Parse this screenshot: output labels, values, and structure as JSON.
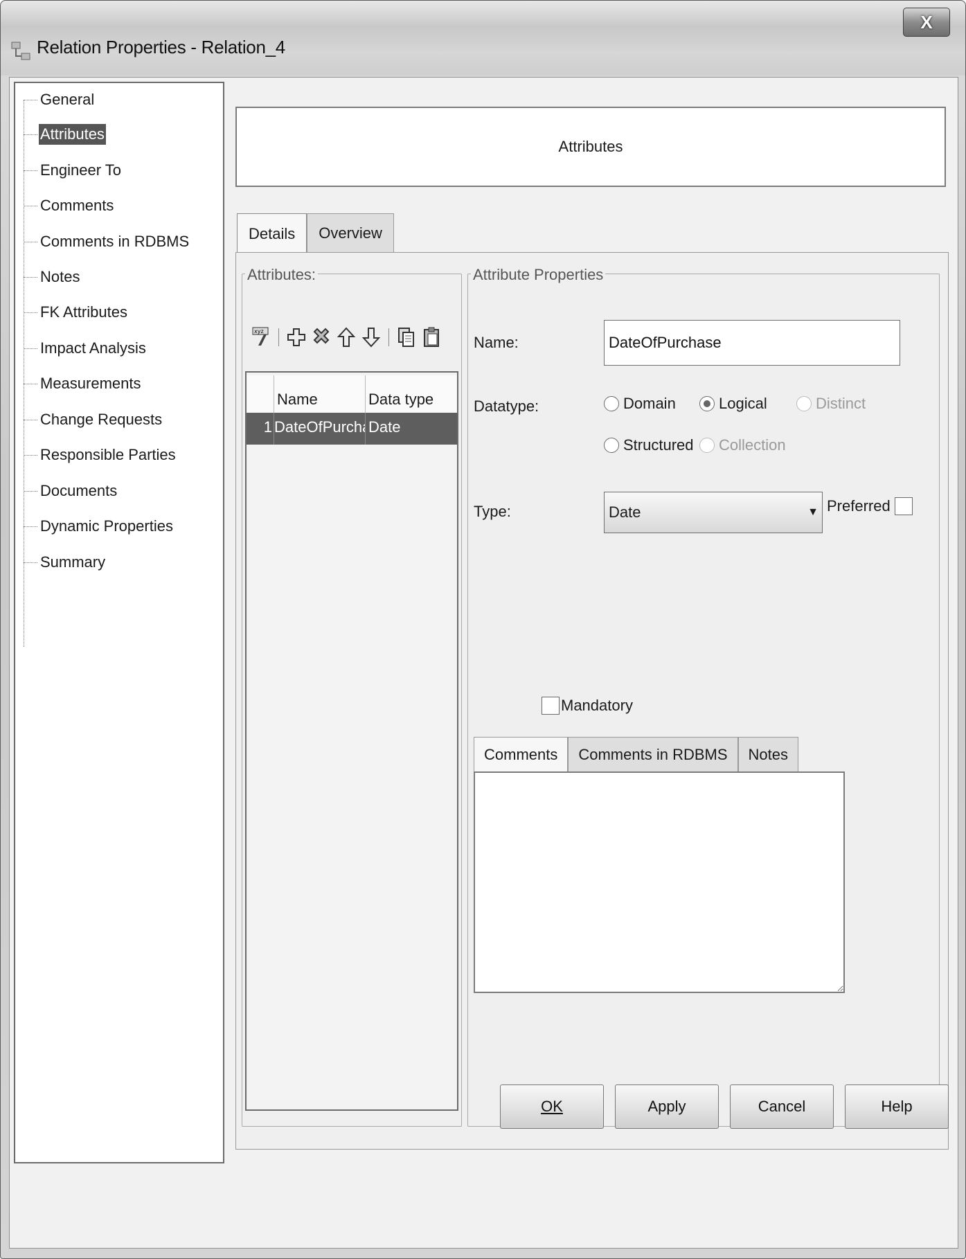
{
  "window": {
    "title": "Relation Properties - Relation_4",
    "close_label": "X"
  },
  "nav": {
    "items": [
      {
        "label": "General",
        "selected": false
      },
      {
        "label": "Attributes",
        "selected": true
      },
      {
        "label": "Engineer To",
        "selected": false
      },
      {
        "label": "Comments",
        "selected": false
      },
      {
        "label": "Comments in RDBMS",
        "selected": false
      },
      {
        "label": "Notes",
        "selected": false
      },
      {
        "label": "FK Attributes",
        "selected": false
      },
      {
        "label": "Impact Analysis",
        "selected": false
      },
      {
        "label": "Measurements",
        "selected": false
      },
      {
        "label": "Change Requests",
        "selected": false
      },
      {
        "label": "Responsible Parties",
        "selected": false
      },
      {
        "label": "Documents",
        "selected": false
      },
      {
        "label": "Dynamic Properties",
        "selected": false
      },
      {
        "label": "Summary",
        "selected": false
      }
    ]
  },
  "header": {
    "title": "Attributes"
  },
  "tabs": [
    {
      "label": "Details",
      "active": true
    },
    {
      "label": "Overview",
      "active": false
    }
  ],
  "attributes_group": {
    "legend": "Attributes:",
    "toolbar_icons": [
      "xyz-properties-icon",
      "add-icon",
      "delete-icon",
      "move-up-icon",
      "move-down-icon",
      "copy-icon",
      "paste-icon"
    ],
    "columns": [
      "Name",
      "Data type"
    ],
    "rows": [
      {
        "index": "1",
        "name": "DateOfPurchase",
        "type": "Date"
      }
    ]
  },
  "attribute_props": {
    "legend": "Attribute Properties",
    "name_label": "Name:",
    "name_value": "DateOfPurchase",
    "datatype_label": "Datatype:",
    "datatype_options": {
      "domain": "Domain",
      "logical": "Logical",
      "distinct": "Distinct",
      "structured": "Structured",
      "collection": "Collection"
    },
    "datatype_selected": "Logical",
    "type_label": "Type:",
    "type_value": "Date",
    "preferred_label": "Preferred",
    "mandatory_label": "Mandatory",
    "inner_tabs": [
      "Comments",
      "Comments in RDBMS",
      "Notes"
    ],
    "active_inner_tab": "Comments"
  },
  "footer": {
    "ok": "OK",
    "apply": "Apply",
    "cancel": "Cancel",
    "help": "Help"
  },
  "colors": {
    "selection": "#5e5e5e",
    "panel": "#efefef"
  }
}
